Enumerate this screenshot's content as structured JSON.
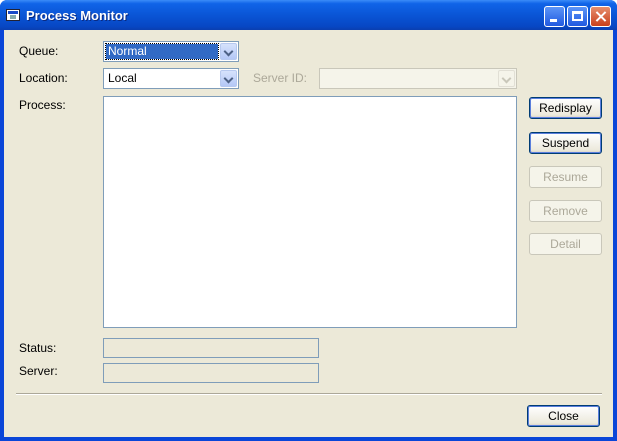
{
  "window": {
    "title": "Process Monitor"
  },
  "form": {
    "queue": {
      "label": "Queue:",
      "value": "Normal"
    },
    "location": {
      "label": "Location:",
      "value": "Local"
    },
    "server_id": {
      "label": "Server ID:",
      "value": ""
    },
    "process": {
      "label": "Process:"
    },
    "status": {
      "label": "Status:",
      "value": ""
    },
    "server": {
      "label": "Server:",
      "value": ""
    }
  },
  "buttons": {
    "redisplay": "Redisplay",
    "suspend": "Suspend",
    "resume": "Resume",
    "remove": "Remove",
    "detail": "Detail",
    "close": "Close"
  },
  "icons": {
    "app": "window-app-icon",
    "minimize": "minimize-icon",
    "maximize": "maximize-icon",
    "close": "close-icon",
    "dropdown": "chevron-down-icon"
  },
  "colors": {
    "titlebar": "#0a55d6",
    "client_bg": "#ece9d8",
    "selection": "#316ac5",
    "disabled_text": "#aca899"
  }
}
